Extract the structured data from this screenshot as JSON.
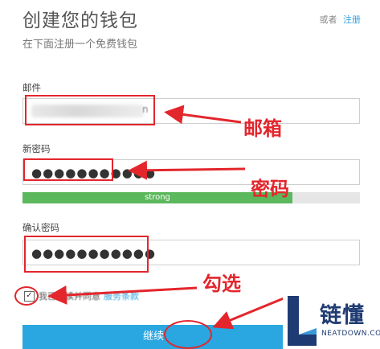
{
  "header": {
    "title": "创建您的钱包",
    "subtitle": "在下面注册一个免费钱包",
    "or_text": "或者",
    "register_link": "注册"
  },
  "form": {
    "email_label": "邮件",
    "email_value_tail": "n",
    "password_label": "新密码",
    "password_value": "●●●●●●●●●●●",
    "strength_text": "strong",
    "strength_level": 0.8,
    "confirm_label": "确认密码",
    "confirm_value": "●●●●●●●●●●●",
    "agree_text": "我已阅读并同意",
    "tos_link": "服务条款",
    "continue_label": "继续"
  },
  "annotations": {
    "email_note": "邮箱",
    "password_note": "密码",
    "check_note": "勾选",
    "color": "#e3262c"
  },
  "watermark": {
    "brand": "链懂",
    "domain": "NEATDOWN.COM"
  }
}
